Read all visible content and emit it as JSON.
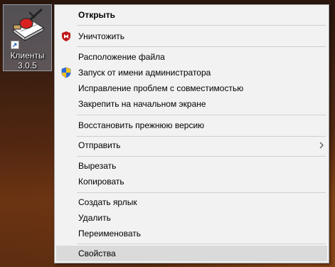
{
  "desktop": {
    "shortcut": {
      "label_line1": "Клиенты",
      "label_line2": "3.0.5",
      "icon": "notebook-pen-icon"
    }
  },
  "context_menu": {
    "open": "Открыть",
    "destroy": "Уничтожить",
    "file_location": "Расположение файла",
    "run_as_admin": "Запуск от имени администратора",
    "troubleshoot_compat": "Исправление проблем с совместимостью",
    "pin_to_start": "Закрепить на начальном экране",
    "restore_previous": "Восстановить прежнюю версию",
    "send_to": "Отправить",
    "cut": "Вырезать",
    "copy": "Копировать",
    "create_shortcut": "Создать ярлык",
    "delete": "Удалить",
    "rename": "Переименовать",
    "properties": "Свойства",
    "icons": {
      "destroy": "mcafee-shield-icon",
      "run_as_admin": "uac-shield-icon",
      "send_to": "chevron-right-icon"
    },
    "colors": {
      "menu_background": "#f2f2f2",
      "hover_background": "#dadada",
      "mcafee_red": "#c01818"
    }
  }
}
